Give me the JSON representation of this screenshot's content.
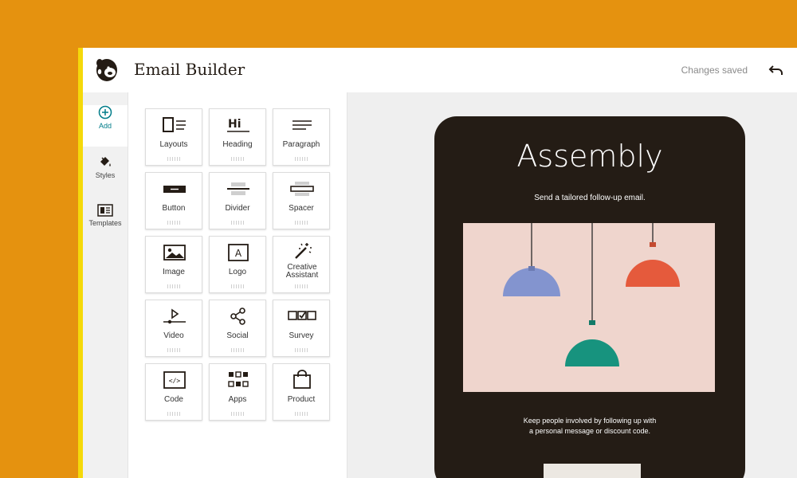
{
  "header": {
    "title": "Email Builder",
    "status": "Changes saved",
    "undo_icon": "undo-icon",
    "logo_icon": "mailchimp-logo"
  },
  "sidebar": {
    "items": [
      {
        "label": "Add",
        "icon": "add-circle-icon",
        "active": true
      },
      {
        "label": "Styles",
        "icon": "paint-bucket-icon",
        "active": false
      },
      {
        "label": "Templates",
        "icon": "template-icon",
        "active": false
      }
    ]
  },
  "blocks": {
    "items": [
      {
        "label": "Layouts",
        "icon": "layouts-icon"
      },
      {
        "label": "Heading",
        "icon": "heading-icon"
      },
      {
        "label": "Paragraph",
        "icon": "paragraph-icon"
      },
      {
        "label": "Button",
        "icon": "button-icon"
      },
      {
        "label": "Divider",
        "icon": "divider-icon"
      },
      {
        "label": "Spacer",
        "icon": "spacer-icon"
      },
      {
        "label": "Image",
        "icon": "image-icon"
      },
      {
        "label": "Logo",
        "icon": "logo-icon"
      },
      {
        "label": "Creative Assistant",
        "icon": "magic-wand-icon"
      },
      {
        "label": "Video",
        "icon": "video-icon"
      },
      {
        "label": "Social",
        "icon": "share-icon"
      },
      {
        "label": "Survey",
        "icon": "survey-icon"
      },
      {
        "label": "Code",
        "icon": "code-icon"
      },
      {
        "label": "Apps",
        "icon": "apps-icon"
      },
      {
        "label": "Product",
        "icon": "shopping-bag-icon"
      }
    ],
    "heading_icon_text": "Hi",
    "logo_icon_text": "A",
    "code_icon_text": "</>"
  },
  "email": {
    "title": "Assembly",
    "subtitle": "Send a tailored follow-up email.",
    "body_line1": "Keep people involved by following up with",
    "body_line2": "a personal message or discount code."
  },
  "colors": {
    "background": "#e5920f",
    "accent_strip": "#f5d90a",
    "phone": "#241c15",
    "teal": "#007c89"
  }
}
